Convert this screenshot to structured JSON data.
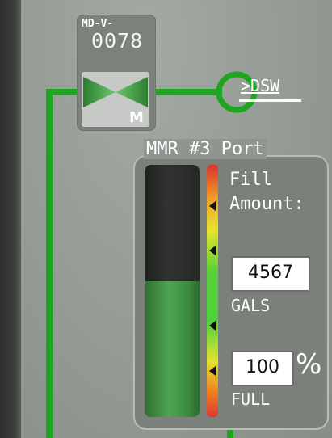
{
  "valve": {
    "id_prefix": "MD-V-",
    "id_number": "0078",
    "mode": "M"
  },
  "destination": {
    "label": ">DSW"
  },
  "tank_group": {
    "title": "MMR #3 Port",
    "fill_label_line1": "Fill",
    "fill_label_line2": "Amount:",
    "amount_value": "4567",
    "amount_unit": "GALS",
    "percent_value": "100",
    "percent_symbol": "%",
    "percent_label": "FULL",
    "fill_level_fraction": 0.54
  },
  "colors": {
    "pipe": "#1fa51f",
    "background": "#949a94",
    "fill": "#3f9a43"
  }
}
